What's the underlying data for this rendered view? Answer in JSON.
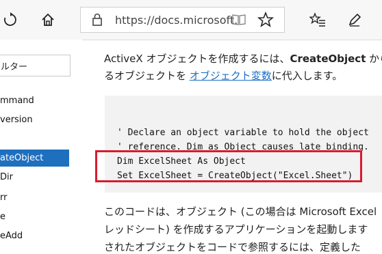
{
  "toolbar": {
    "url": "https://docs.microsoft."
  },
  "sidebar": {
    "filter_text": "ルター",
    "items": [
      {
        "label": "mmand"
      },
      {
        "label": "version"
      },
      {
        "label": "ateObject"
      },
      {
        "label": "Dir"
      },
      {
        "label": "rr"
      },
      {
        "label": "e"
      },
      {
        "label": "eAdd"
      }
    ]
  },
  "content": {
    "p1_a": "ActiveX オブジェクトを作成するには、",
    "p1_b": "CreateObject",
    "p1_c": " から",
    "p2_a": "るオブジェクトを ",
    "p2_link": "オブジェクト変数",
    "p2_b": "に代入します。",
    "code_lines": [
      "' Declare an object variable to hold the object",
      "' reference. Dim as Object causes late binding.",
      "Dim ExcelSheet As Object",
      "Set ExcelSheet = CreateObject(\"Excel.Sheet\")"
    ],
    "p3": "このコードは、オブジェクト (この場合は Microsoft Excel",
    "p4": "レッドシート) を作成するアプリケーションを起動します",
    "p5": "されたオブジェクトをコードで参照するには、定義した",
    "colors": {
      "accent": "#1f6fbf",
      "highlight": "#d81b2f",
      "link": "#1a6fc4"
    }
  }
}
